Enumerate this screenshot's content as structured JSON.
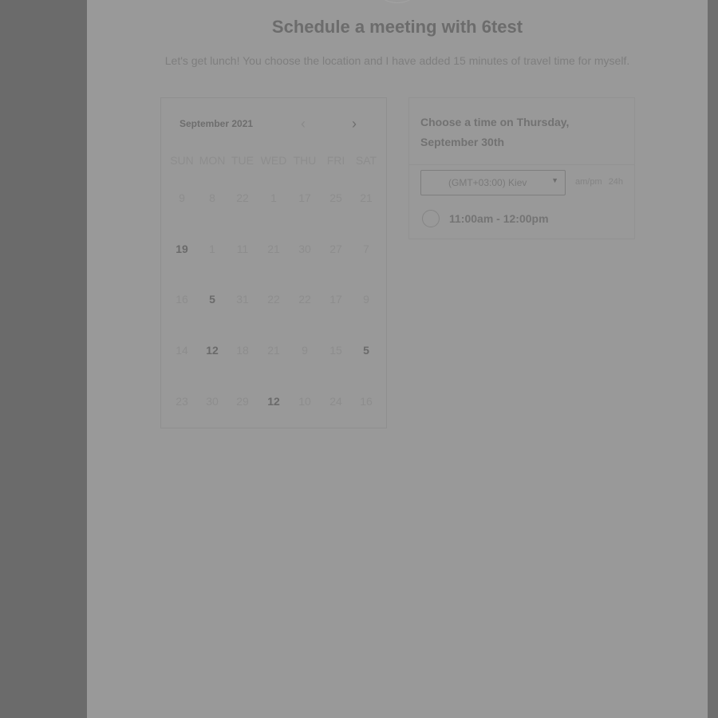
{
  "header": {
    "title": "Schedule a meeting with 6test",
    "description": "Let's get lunch! You choose the location and I have added 15 minutes of travel time for myself."
  },
  "calendar": {
    "month_label": "September 2021",
    "weekdays": [
      "SUN",
      "MON",
      "TUE",
      "WED",
      "THU",
      "FRI",
      "SAT"
    ],
    "weeks": [
      [
        {
          "d": "9"
        },
        {
          "d": "8"
        },
        {
          "d": "22"
        },
        {
          "d": "1"
        },
        {
          "d": "17"
        },
        {
          "d": "25"
        },
        {
          "d": "21"
        }
      ],
      [
        {
          "d": "19",
          "on": true
        },
        {
          "d": "1"
        },
        {
          "d": "11"
        },
        {
          "d": "21"
        },
        {
          "d": "30"
        },
        {
          "d": "27"
        },
        {
          "d": "7"
        }
      ],
      [
        {
          "d": "16"
        },
        {
          "d": "5",
          "on": true
        },
        {
          "d": "31"
        },
        {
          "d": "22"
        },
        {
          "d": "22"
        },
        {
          "d": "17"
        },
        {
          "d": "9"
        }
      ],
      [
        {
          "d": "14"
        },
        {
          "d": "12",
          "on": true
        },
        {
          "d": "18"
        },
        {
          "d": "21"
        },
        {
          "d": "9"
        },
        {
          "d": "15"
        },
        {
          "d": "5",
          "on": true
        }
      ],
      [
        {
          "d": "23"
        },
        {
          "d": "30"
        },
        {
          "d": "29"
        },
        {
          "d": "12",
          "on": true
        },
        {
          "d": "10"
        },
        {
          "d": "24"
        },
        {
          "d": "16"
        }
      ]
    ]
  },
  "times": {
    "heading": "Choose a time on Thursday, September 30th",
    "timezone": "(GMT+03:00) Kiev",
    "format_ampm": "am/pm",
    "format_24h": "24h",
    "slots": [
      "11:00am - 12:00pm"
    ]
  }
}
